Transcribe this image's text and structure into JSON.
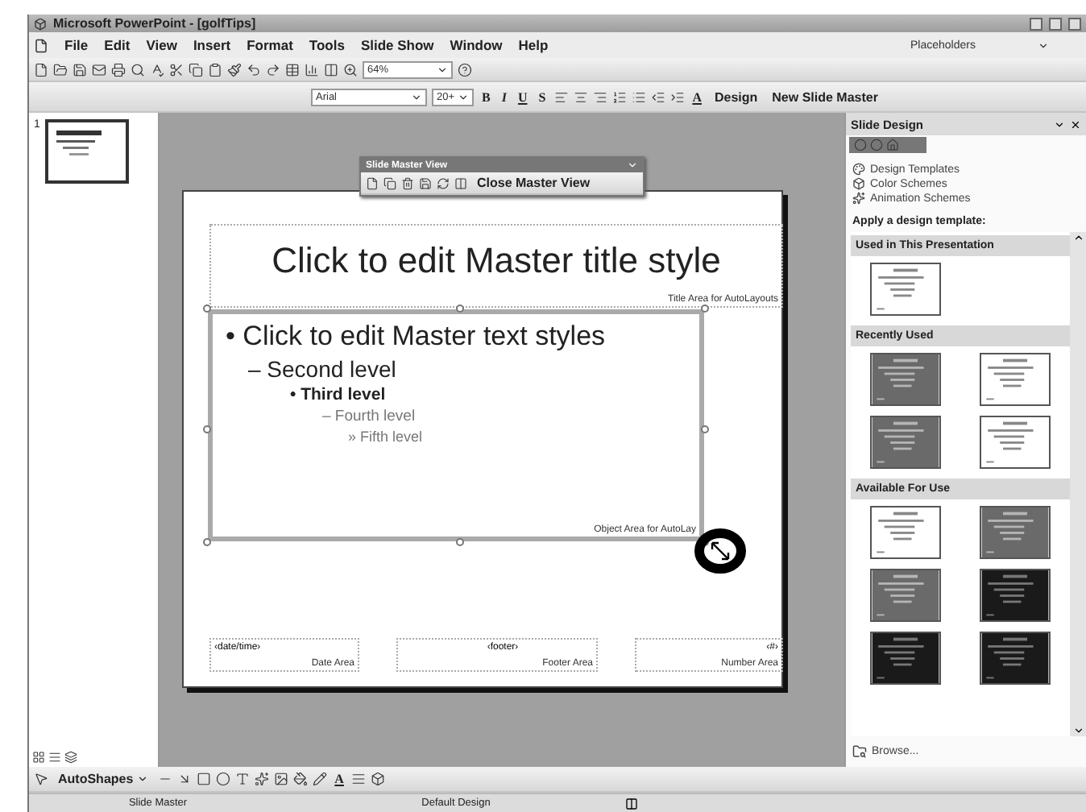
{
  "window": {
    "title": "Microsoft PowerPoint - [golfTips]"
  },
  "menu": [
    "File",
    "Edit",
    "View",
    "Insert",
    "Format",
    "Tools",
    "Slide Show",
    "Window",
    "Help"
  ],
  "help_box": {
    "value": "Placeholders"
  },
  "standard_toolbar": {
    "zoom": "64%"
  },
  "formatting_toolbar": {
    "font": "Arial",
    "size": "20+",
    "style_buttons": [
      "B",
      "I",
      "U",
      "S"
    ],
    "font_color": "A",
    "buttons": [
      "Design",
      "New Slide Master"
    ]
  },
  "thumbnail_pane": {
    "slides": [
      {
        "number": "1",
        "selected": true
      }
    ]
  },
  "master_toolbar": {
    "title": "Slide Master View",
    "close": "Close Master View"
  },
  "slide": {
    "title": "Click to edit Master title style",
    "title_area": "Title Area for AutoLayouts",
    "levels": [
      {
        "text": "Click to edit Master text styles",
        "bullet": "•"
      },
      {
        "text": "Second level",
        "bullet": "–"
      },
      {
        "text": "Third level",
        "bullet": "•"
      },
      {
        "text": "Fourth level",
        "bullet": "–"
      },
      {
        "text": "Fifth level",
        "bullet": "»"
      }
    ],
    "object_area": "Object Area for AutoLay",
    "footers": [
      {
        "field": "‹date/time›",
        "label": "Date Area"
      },
      {
        "field": "‹footer›",
        "label": "Footer Area"
      },
      {
        "field": "‹#›",
        "label": "Number Area"
      }
    ]
  },
  "task_pane": {
    "title": "Slide Design",
    "links": [
      "Design Templates",
      "Color Schemes",
      "Animation Schemes"
    ],
    "heading": "Apply a design template:",
    "sections": [
      {
        "title": "Used in This Presentation",
        "thumbs": [
          {
            "kind": "light"
          }
        ]
      },
      {
        "title": "Recently Used",
        "thumbs": [
          {
            "kind": "gray"
          },
          {
            "kind": "light"
          },
          {
            "kind": "gray"
          },
          {
            "kind": "light"
          }
        ]
      },
      {
        "title": "Available For Use",
        "thumbs": [
          {
            "kind": "light"
          },
          {
            "kind": "gray"
          },
          {
            "kind": "gray"
          },
          {
            "kind": "dark"
          },
          {
            "kind": "dark"
          },
          {
            "kind": "dark"
          }
        ]
      }
    ],
    "browse": "Browse..."
  },
  "drawing_toolbar": {
    "autoshapes": "AutoShapes",
    "font_color": "A"
  },
  "status_bar": [
    "Slide Master",
    "Default Design"
  ]
}
